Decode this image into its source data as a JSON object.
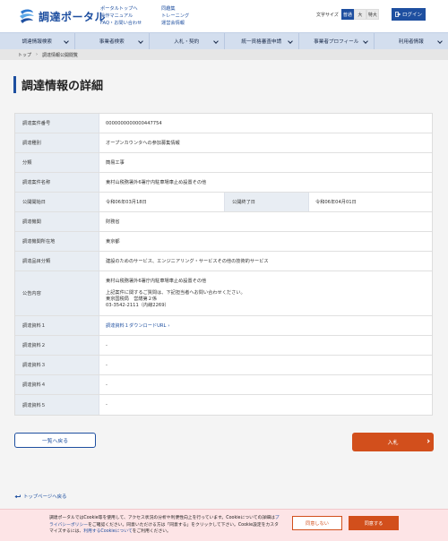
{
  "header": {
    "logo_text": "調達ポータル",
    "links_col1": [
      "ポータルトップへ",
      "操作マニュアル",
      "FAQ・お問い合わせ"
    ],
    "links_col2": [
      "同趣集",
      "トレーニング",
      "運営会情報"
    ],
    "font_size_label": "文字サイズ",
    "font_sizes": [
      "普通",
      "大",
      "特大"
    ],
    "login_label": "ログイン",
    "accent": "#1e4fa0"
  },
  "nav": {
    "items": [
      "調達情報検索",
      "事業者検索",
      "入札・契約",
      "統一資格審査申請",
      "事業者プロフィール",
      "利用者情報"
    ]
  },
  "breadcrumb": {
    "home": "トップ",
    "current": "調達情報公開閲覧"
  },
  "page_title": "調達情報の詳細",
  "details": {
    "case_number_label": "調達案件番号",
    "case_number": "0000000000000447754",
    "type_label": "調達種別",
    "type": "オープンカウンタへの参加募集情報",
    "category_label": "分類",
    "category": "簡易工事",
    "name_label": "調達案件名称",
    "name": "東村山税務署外6署庁内駐車場車止め設置その他",
    "start_label": "公開開始日",
    "start": "令和06年03月18日",
    "end_label": "公開終了日",
    "end": "令和06年04月01日",
    "org_label": "調達機関",
    "org": "財務省",
    "location_label": "調達機関所在地",
    "location": "東京都",
    "item_label": "調達品目分類",
    "item": "建設のためのサービス、エンジニアリング・サービスその他の技術的サービス",
    "notice_label": "公告内容",
    "notice_lines": [
      "東村山税務署外6署庁内駐車場車止め設置その他",
      "",
      "上記案件に関するご質問は、下記担当者へお問い合わせください。",
      "東京国税局　営繕第２係",
      "03-3542-2111（内線2269）"
    ],
    "doc1_label": "調達資料１",
    "doc1": "調達資料１ダウンロードURL",
    "doc2_label": "調達資料２",
    "doc2": "-",
    "doc3_label": "調達資料３",
    "doc3": "-",
    "doc4_label": "調達資料４",
    "doc4": "-",
    "doc5_label": "調達資料５",
    "doc5": "-"
  },
  "buttons": {
    "back": "一覧へ戻る",
    "bid": "入札"
  },
  "top_link": "トップページへ戻る",
  "cookie": {
    "text_1": "調達ポータルではCookie等を使用して、アクセス状況の分析や利便性向上を行っています。Cookieについての詳細は",
    "privacy_link": "プライバシーポリシー",
    "text_2": "をご確認ください。同意いただける方は「同意する」をクリックして下さい。Cookie設定をカスタマイズするには、",
    "settings_link": "利用するCookieについて",
    "text_3": "をご利用ください。",
    "reject": "同意しない",
    "accept": "同意する"
  }
}
